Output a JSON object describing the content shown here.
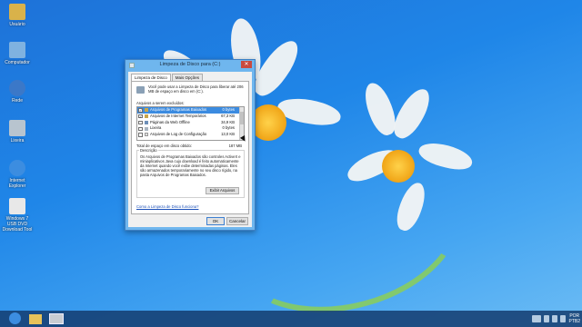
{
  "desktop": {
    "icons": [
      {
        "label": "Usuário",
        "icon": "user-folder-icon",
        "color": "#d9b24a"
      },
      {
        "label": "Computador",
        "icon": "computer-icon",
        "color": "#7fb2e0"
      },
      {
        "label": "Rede",
        "icon": "network-icon",
        "color": "#3b78c8"
      },
      {
        "label": "Lixeira",
        "icon": "recycle-bin-icon",
        "color": "#b8c4cf"
      },
      {
        "label": "Internet Explorer",
        "icon": "internet-explorer-icon",
        "color": "#3c8de0"
      },
      {
        "label": "Windows 7 USB DVD Download Tool",
        "icon": "usb-dvd-tool-icon",
        "color": "#e8e8e8"
      }
    ]
  },
  "dialog": {
    "title": "Limpeza de Disco para  (C:)",
    "tabs": [
      "Limpeza de Disco",
      "Mais Opções"
    ],
    "intro": "Você pode usar a Limpeza de Disco para liberar até 206 MB de espaço em disco em  (C:).",
    "files_label": "Arquivos a serem excluídos:",
    "files": [
      {
        "checked": true,
        "name": "Arquivos de Programas Baixados",
        "size": "0 bytes",
        "selected": true
      },
      {
        "checked": true,
        "name": "Arquivos de Internet Temporários",
        "size": "67,3 KB",
        "selected": false
      },
      {
        "checked": false,
        "name": "Páginas da Web Offline",
        "size": "34,9 KB",
        "selected": false
      },
      {
        "checked": false,
        "name": "Lixeira",
        "size": "0 bytes",
        "selected": false
      },
      {
        "checked": false,
        "name": "Arquivos de Log de Configuração",
        "size": "13,0 KB",
        "selected": false
      }
    ],
    "total_label": "Total de espaço em disco obtido:",
    "total_value": "187 MB",
    "description_title": "Descrição",
    "description": "Os Arquivos de Programas Baixados são controles ActiveX e miniaplicativos Java cujo download é feito automaticamente da Internet quando você exibe determinadas páginas. Eles são armazenados temporariamente no seu disco rígido, na pasta Arquivos de Programas Baixados.",
    "view_files_label": "Exibir Arquivos",
    "help_link": "Como a Limpeza de Disco funciona?",
    "ok_label": "OK",
    "cancel_label": "Cancelar",
    "close_label": "✕"
  },
  "taskbar": {
    "apps": [
      {
        "icon": "internet-explorer-icon",
        "color": "#3c8de0"
      },
      {
        "icon": "file-explorer-icon",
        "color": "#e6c25a"
      },
      {
        "icon": "disk-cleanup-icon",
        "color": "#c8ccd2"
      }
    ],
    "language": "POR",
    "layout": "PTB2"
  }
}
